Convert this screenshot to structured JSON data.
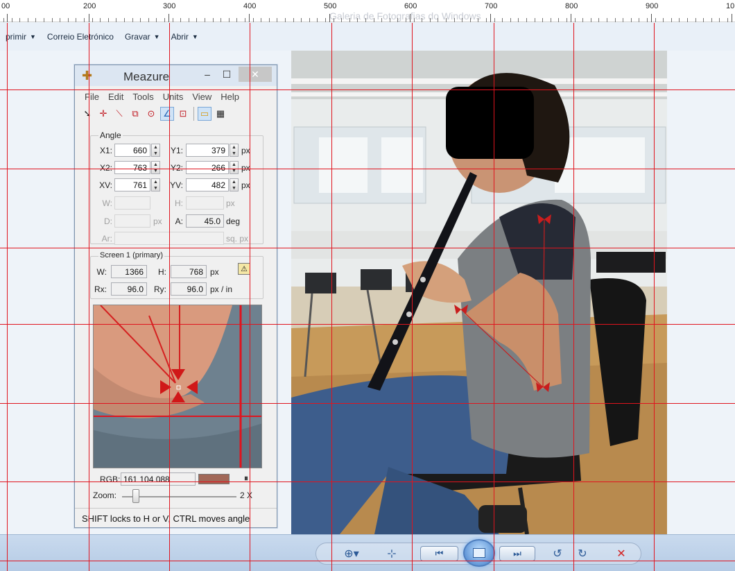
{
  "viewer": {
    "title": "Galeria de Fotografias do Windows",
    "ruler_labels": [
      "00",
      "200",
      "300",
      "400",
      "500",
      "600",
      "700",
      "800",
      "900",
      "10"
    ],
    "menu": [
      {
        "label": "primir"
      },
      {
        "label": "Correio Eletrónico"
      },
      {
        "label": "Gravar"
      },
      {
        "label": "Abrir"
      }
    ],
    "bottom_bar_icons": [
      "zoom-icon",
      "actual-size-icon",
      "previous-icon",
      "slideshow-icon",
      "next-icon",
      "rotate-left-icon",
      "rotate-right-icon",
      "delete-icon"
    ],
    "colors": {
      "grid": "#e0141e",
      "toolbar_top": "#c9daee",
      "bottom_glyph": "#2c5a97"
    }
  },
  "meazure": {
    "title": "Meazure",
    "window_buttons": [
      "–",
      "☐",
      "✕"
    ],
    "menu": [
      "File",
      "Edit",
      "Tools",
      "Units",
      "View",
      "Help"
    ],
    "tools": [
      "cursor-tool-icon",
      "point-tool-icon",
      "line-tool-icon",
      "rectangle-tool-icon",
      "circle-tool-icon",
      "angle-tool-icon",
      "window-tool-icon",
      "ruler-icon",
      "grid-icon"
    ],
    "angle": {
      "legend": "Angle",
      "x1_label": "X1:",
      "x1": "660",
      "y1_label": "Y1:",
      "y1": "379",
      "x2_label": "X2:",
      "x2": "763",
      "y2_label": "Y2:",
      "y2": "266",
      "xv_label": "XV:",
      "xv": "761",
      "yv_label": "YV:",
      "yv": "482",
      "w_label": "W:",
      "h_label": "H:",
      "d_label": "D:",
      "a_label": "A:",
      "a": "45.0",
      "ar_label": "Ar:",
      "unit_px": "px",
      "unit_deg": "deg",
      "unit_sqpx": "sq. px"
    },
    "screen": {
      "legend": "Screen 1 (primary)",
      "w_label": "W:",
      "w": "1366",
      "h_label": "H:",
      "h": "768",
      "rx_label": "Rx:",
      "rx": "96.0",
      "ry_label": "Ry:",
      "ry": "96.0",
      "unit_px": "px",
      "unit_res": "px / in",
      "warning_icon": "warning-icon"
    },
    "rgb_label": "RGB:",
    "rgb_value": "161 104 088",
    "rgb_swatch": "#a16858",
    "zoom_label": "Zoom:",
    "zoom_value": "2 X",
    "zoom_level": 0.12,
    "status": "SHIFT locks to H or V, CTRL moves angle"
  }
}
